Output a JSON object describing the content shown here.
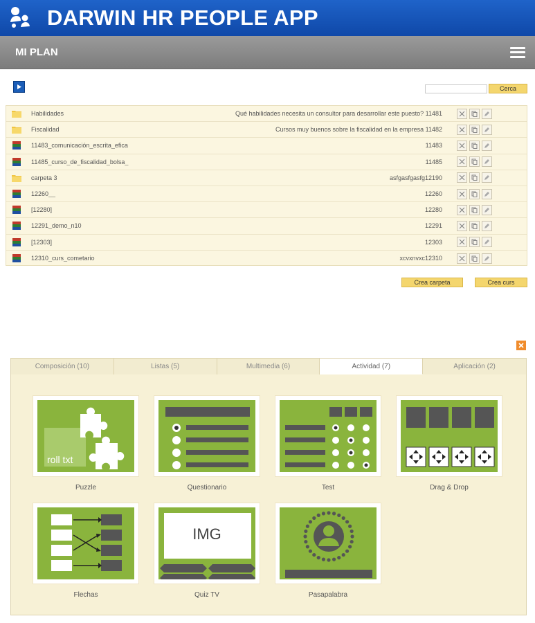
{
  "header": {
    "title": "DARWIN HR PEOPLE APP",
    "section": "MI PLAN"
  },
  "toolbar": {
    "search_placeholder": "",
    "search_button": "Cerca"
  },
  "files": [
    {
      "type": "folder",
      "name": "Habilidades",
      "desc": "Qué habilidades necesita un consultor para desarrollar este puesto? 11481"
    },
    {
      "type": "folder",
      "name": "Fiscalidad",
      "desc": "Cursos muy buenos sobre la fiscalidad en la empresa 11482"
    },
    {
      "type": "book",
      "name": "11483_comunicación_escrita_efica",
      "desc": "11483"
    },
    {
      "type": "book",
      "name": "11485_curso_de_fiscalidad_bolsa_",
      "desc": "11485"
    },
    {
      "type": "folder",
      "name": "carpeta 3",
      "desc": "asfgasfgasfg12190"
    },
    {
      "type": "book",
      "name": "12260__",
      "desc": "12260"
    },
    {
      "type": "book",
      "name": "[12280]",
      "desc": "12280"
    },
    {
      "type": "book",
      "name": "12291_demo_n10",
      "desc": "12291"
    },
    {
      "type": "book",
      "name": "[12303]",
      "desc": "12303"
    },
    {
      "type": "book",
      "name": "12310_curs_cometario",
      "desc": "xcvxnvxc12310"
    }
  ],
  "actions": {
    "create_folder": "Crea carpeta",
    "create_course": "Crea curs"
  },
  "tabs": [
    {
      "label": "Composición (10)",
      "active": false
    },
    {
      "label": "Listas (5)",
      "active": false
    },
    {
      "label": "Multimedia (6)",
      "active": false
    },
    {
      "label": "Actividad (7)",
      "active": true
    },
    {
      "label": "Aplicación (2)",
      "active": false
    }
  ],
  "activities": [
    {
      "label": "Puzzle",
      "art_text": "roll txt"
    },
    {
      "label": "Questionario"
    },
    {
      "label": "Test"
    },
    {
      "label": "Drag & Drop"
    },
    {
      "label": "Flechas"
    },
    {
      "label": "Quiz TV",
      "art_text": "IMG"
    },
    {
      "label": "Pasapalabra"
    }
  ],
  "colors": {
    "brand_blue": "#1f63c9",
    "grey_bar": "#8a8a8a",
    "tile_green": "#8ab43d",
    "button_yellow": "#f4d66e",
    "close_orange": "#f08c2c"
  },
  "icons": {
    "folder": "folder-icon",
    "book": "course-book-icon",
    "delete": "delete-icon",
    "copy": "copy-icon",
    "edit": "edit-icon"
  }
}
